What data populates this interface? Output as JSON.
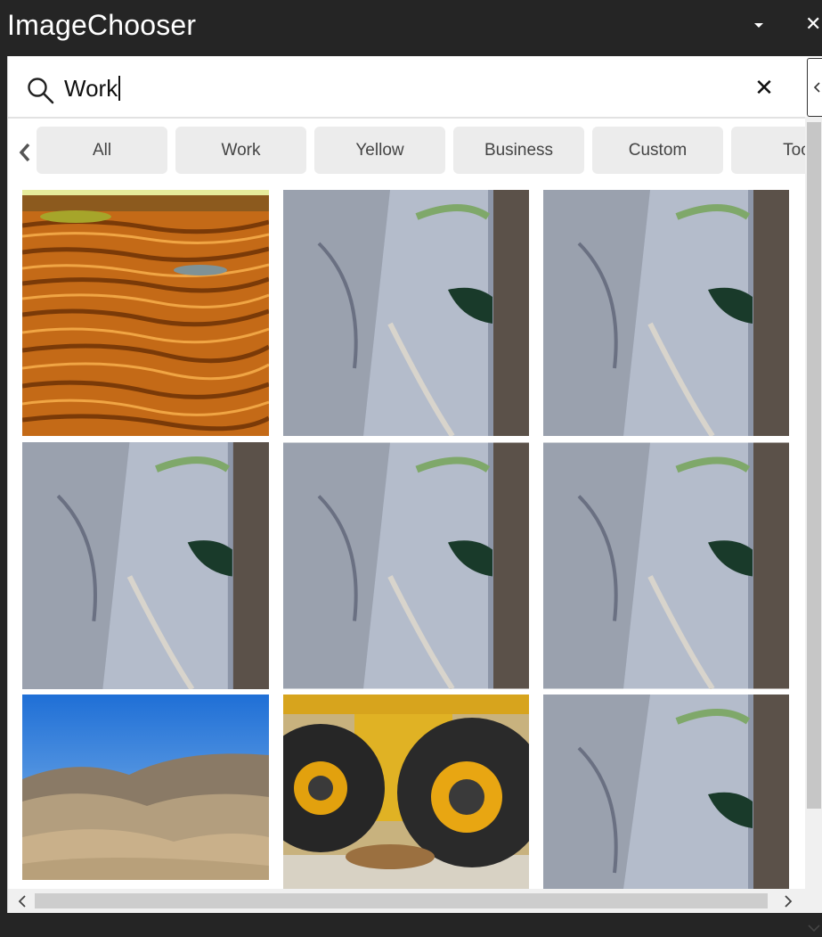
{
  "window": {
    "title": "ImageChooser"
  },
  "search": {
    "query": "Work"
  },
  "icons": {
    "search": "search-icon",
    "clear": "close-icon",
    "dropdown": "chevron-down-icon",
    "window_close": "close-icon",
    "chips_prev": "chevron-left-icon",
    "collapse": "chevron-left-icon"
  },
  "colors": {
    "titlebar": "#252525",
    "chip_bg": "#ececec",
    "chip_text": "#444444",
    "scrollbar": "#f0f0f0"
  },
  "filters": {
    "chips": [
      "All",
      "Work",
      "Yellow",
      "Business",
      "Custom",
      "Too"
    ]
  },
  "results": {
    "images": [
      {
        "subject": "terraced-earth"
      },
      {
        "subject": "quarry-rock"
      },
      {
        "subject": "quarry-rock"
      },
      {
        "subject": "quarry-rock"
      },
      {
        "subject": "quarry-rock"
      },
      {
        "subject": "quarry-rock"
      },
      {
        "subject": "desert-hills"
      },
      {
        "subject": "truck-tires"
      },
      {
        "subject": "quarry-rock"
      }
    ]
  }
}
